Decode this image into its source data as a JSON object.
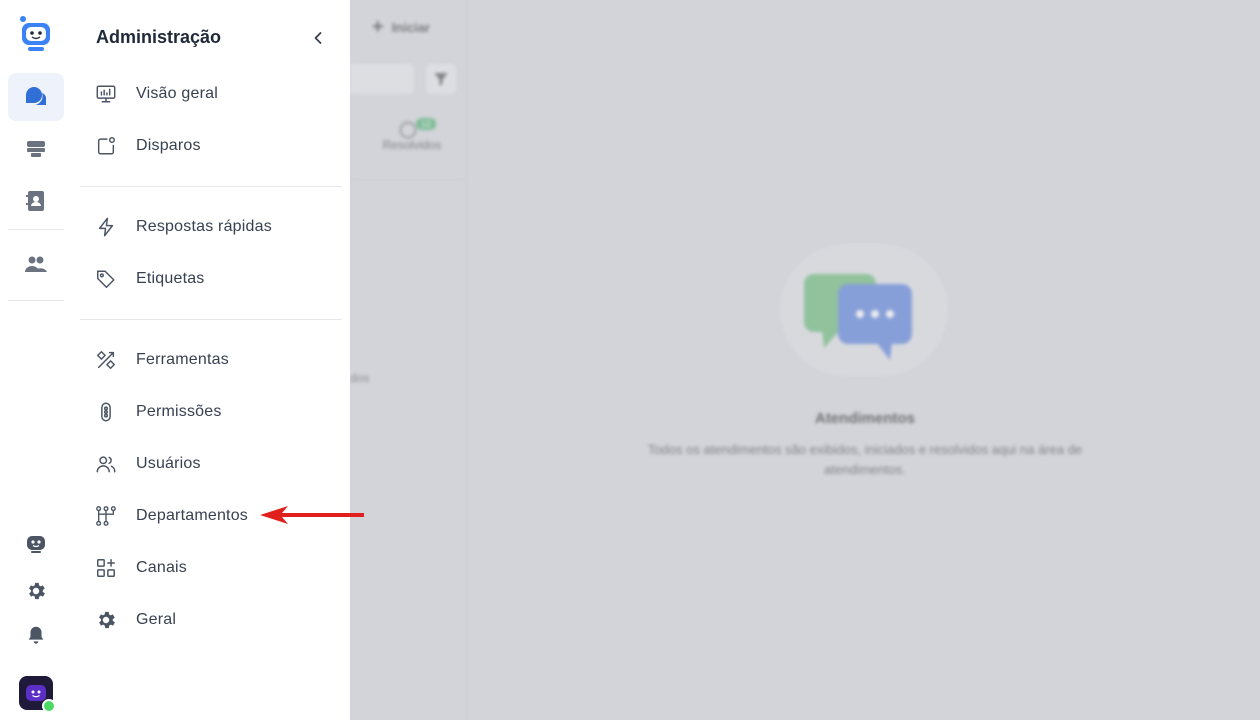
{
  "panel": {
    "title": "Administração",
    "groups": [
      [
        {
          "label": "Visão geral",
          "icon": "monitor-chart-icon"
        },
        {
          "label": "Disparos",
          "icon": "broadcast-square-icon"
        }
      ],
      [
        {
          "label": "Respostas rápidas",
          "icon": "lightning-icon"
        },
        {
          "label": "Etiquetas",
          "icon": "tag-icon"
        }
      ],
      [
        {
          "label": "Ferramentas",
          "icon": "tools-icon"
        },
        {
          "label": "Permissões",
          "icon": "toggle-vertical-icon"
        },
        {
          "label": "Usuários",
          "icon": "users-icon"
        },
        {
          "label": "Departamentos",
          "icon": "org-chart-icon"
        },
        {
          "label": "Canais",
          "icon": "apps-add-icon"
        },
        {
          "label": "Geral",
          "icon": "gear-icon"
        }
      ]
    ]
  },
  "rail": {
    "top_items": [
      "robot-logo-icon",
      "chat-bubbles-icon",
      "inbox-icon",
      "contacts-book-icon",
      "team-icon"
    ],
    "bottom_items": [
      "bot-icon",
      "settings-gear-icon",
      "bell-icon",
      "user-avatar"
    ],
    "status": "online"
  },
  "background": {
    "new_button_label": "Iniciar",
    "tab_label": "Resolvidos",
    "tab_badge": "12",
    "fragment": "dos",
    "empty_title": "Atendimentos",
    "empty_desc": "Todos os atendimentos são exibidos, iniciados e resolvidos aqui na área de atendimentos."
  },
  "colors": {
    "accent": "#2f6fd6",
    "annotation_arrow": "#e0201c",
    "online": "#4cd964",
    "avatar": "#5b2fc6"
  }
}
